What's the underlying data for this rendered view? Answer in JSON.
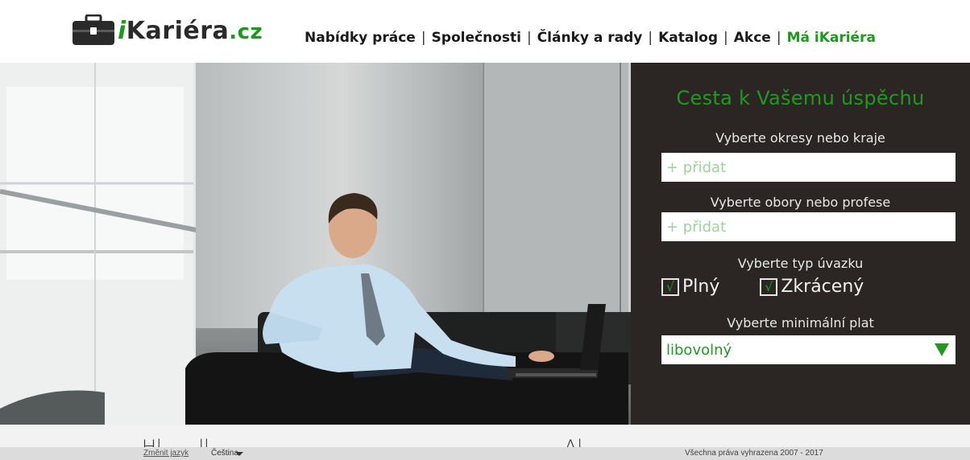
{
  "logo": {
    "prefix": "i",
    "name": "Kariéra",
    "tld": ".cz"
  },
  "nav": {
    "items": [
      {
        "label": "Nabídky práce"
      },
      {
        "label": "Společnosti"
      },
      {
        "label": "Články a rady"
      },
      {
        "label": "Katalog"
      },
      {
        "label": "Akce"
      },
      {
        "label": "Má iKariéra"
      }
    ],
    "separator": "|"
  },
  "search": {
    "title": "Cesta k Vašemu úspěchu",
    "region_label": "Vyberte okresy nebo kraje",
    "region_placeholder": "+ přidat",
    "field_label": "Vyberte obory nebo profese",
    "field_placeholder": "+ přidat",
    "type_label": "Vyberte typ úvazku",
    "types": [
      {
        "label": "Plný",
        "checked": true,
        "mark": "√"
      },
      {
        "label": "Zkrácený",
        "checked": true,
        "mark": "√"
      }
    ],
    "salary_label": "Vyberte minimální plat",
    "salary_value": "libovolný"
  },
  "footer": {
    "change_language": "Změnit jazyk",
    "language": "Čeština",
    "rights": "Všechna práva vyhrazena 2007 - 2017"
  },
  "colors": {
    "accent": "#1e9b1e",
    "panel_bg": "#2b2624",
    "nav_text": "#1a1a1a"
  }
}
